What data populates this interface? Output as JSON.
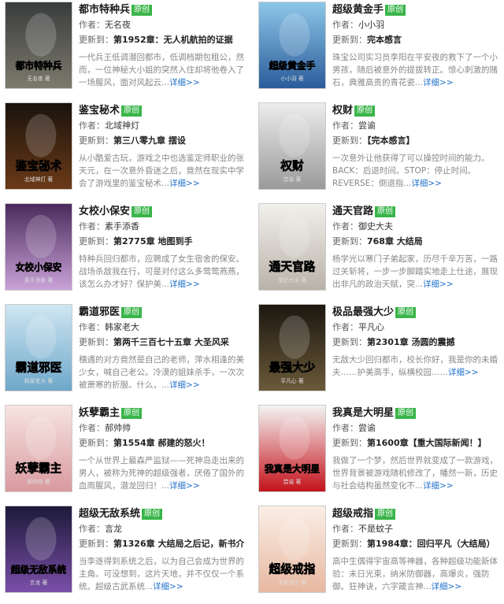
{
  "labels": {
    "author": "作者：",
    "updated": "更新到：",
    "tag": "原创",
    "more": "详细>>"
  },
  "books": [
    {
      "title": "都市特种兵",
      "author": "无名夜",
      "latest": "第1952章：无人机航拍的证据",
      "desc": "一代兵王低调潜回都市，低调档期包租公，然而，一位神秘大小姐的突然入住却将他卷入了一场腥风，面对风起云...",
      "cover_text": "都市特种兵",
      "cover_sub": "无名夜 著",
      "colors": [
        "#3a3d3e",
        "#7d7a6c"
      ]
    },
    {
      "title": "超级黄金手",
      "author": "小小羽",
      "latest": "完本感言",
      "desc": "珠宝公司实习员李阳在平安夜的救下了一个小男孩，随后被意外的提拔转正。惊心刺激的赌石，典雅高贵的青花瓷...",
      "cover_text": "超级黄金手",
      "cover_sub": "小小羽 著",
      "colors": [
        "#8dc6e8",
        "#2a5c9a"
      ]
    },
    {
      "title": "鉴宝秘术",
      "author": "北域神灯",
      "latest": "第三八零九章 摆设",
      "desc": "从小酷爱古玩，游戏之中也选鉴定师职业的张天元，在一次意外昏迷之后，竟然在现实中学会了游戏里的鉴宝秘术...",
      "cover_text": "鉴宝秘术",
      "cover_sub": "北域神灯 著",
      "colors": [
        "#1a120c",
        "#6b3a18"
      ]
    },
    {
      "title": "权财",
      "author": "尝谕",
      "latest": "【完本感言】",
      "desc": "一次意外让他获得了可以操控时间的能力。BACK：后退时间。STOP：停止时间。REVERSE：倒退指...",
      "cover_text": "权财",
      "cover_sub": "尝谕 著",
      "colors": [
        "#ececec",
        "#9a9a9a"
      ]
    },
    {
      "title": "女校小保安",
      "author": "素手添香",
      "latest": "第2775章 地图到手",
      "desc": "特种兵回归都市，应聘成了女生宿舍的保安。战场杀敌我在行，可是对付这么多莺莺燕燕，该怎么办才好？保护美...",
      "cover_text": "女校小保安",
      "cover_sub": "素手添香 著",
      "colors": [
        "#4a2a5c",
        "#c9a2d8"
      ]
    },
    {
      "title": "通天官路",
      "author": "御史大夫",
      "latest": "768章 大结局",
      "desc": "杨学光以寒门子弟起家，历尽千辛万苦，一路过关斩将，一步一步脚踏实地走上仕途，展现出非凡的政治天赋，突...",
      "cover_text": "通天官路",
      "cover_sub": "御史大夫 著",
      "colors": [
        "#f2f0ec",
        "#b9b2a8"
      ]
    },
    {
      "title": "霸道邪医",
      "author": "韩家老大",
      "latest": "第两千三百七十五章 大圣风采",
      "desc": "穗遇的对方竟然是自己的老师，萍水相逢的美少女，喊自己老公。冷漠的姐妹杀手，一次次被萧寒的折服。什么，...",
      "cover_text": "霸道邪医",
      "cover_sub": "韩家老大 著",
      "colors": [
        "#cfe6f2",
        "#6ea7c9"
      ]
    },
    {
      "title": "极品最强大少",
      "author": "平凡心",
      "latest": "第2301章 汤圆的震撼",
      "desc": "无敌大少回归都市，校长你好，我是你的未婚夫……护美高手，纵横校园……",
      "cover_text": "最强大少",
      "cover_sub": "平凡心 著",
      "colors": [
        "#1c1710",
        "#6b5a3a"
      ]
    },
    {
      "title": "妖孽霸主",
      "author": "郝帅帅",
      "latest": "第1554章 郝建的怒火！",
      "desc": "一个从世界上最森严监狱——死神岛走出来的男人，被称为死神的超级强者，厌倦了国外的血雨腥风，潜龙回归！...",
      "cover_text": "妖孽霸主",
      "cover_sub": "郝帅帅 著",
      "colors": [
        "#f6e4e0",
        "#d99aa0"
      ]
    },
    {
      "title": "我真是大明星",
      "author": "尝谕",
      "latest": "第1600章【重大国际新闻！】",
      "desc": "我做了一个梦，然后世界就变成了一款游戏，世界背景被游戏随机修改了，幡然一新，历史与社会结构虽然变化不...",
      "cover_text": "我真是大明星",
      "cover_sub": "尝谕 著",
      "colors": [
        "#f4f4f4",
        "#c4121a"
      ]
    },
    {
      "title": "超级无敌系统",
      "author": "言龙",
      "latest": "第1326章 大结局之后记，新书介",
      "desc": "当李逐得到系统之后，以为自己会成为世界的主角。可没想到，这片天地，并不仅仅一个系统。超级古武系统...",
      "cover_text": "超级无敌系统",
      "cover_sub": "言龙 著",
      "colors": [
        "#1d1a3a",
        "#7a4fa8"
      ]
    },
    {
      "title": "超级戒指",
      "author": "不是蚊子",
      "latest": "第1984章：回归平凡（大结局）",
      "desc": "高中生偶得宇宙高等神器，各种超级功能新体验：未日光束，纳米防御器，高爆炎，强防御。狂神诀，六字箴言神...",
      "cover_text": "超级戒指",
      "cover_sub": "不是蚊子 著",
      "colors": [
        "#fbeee6",
        "#e7b8a0"
      ]
    }
  ]
}
